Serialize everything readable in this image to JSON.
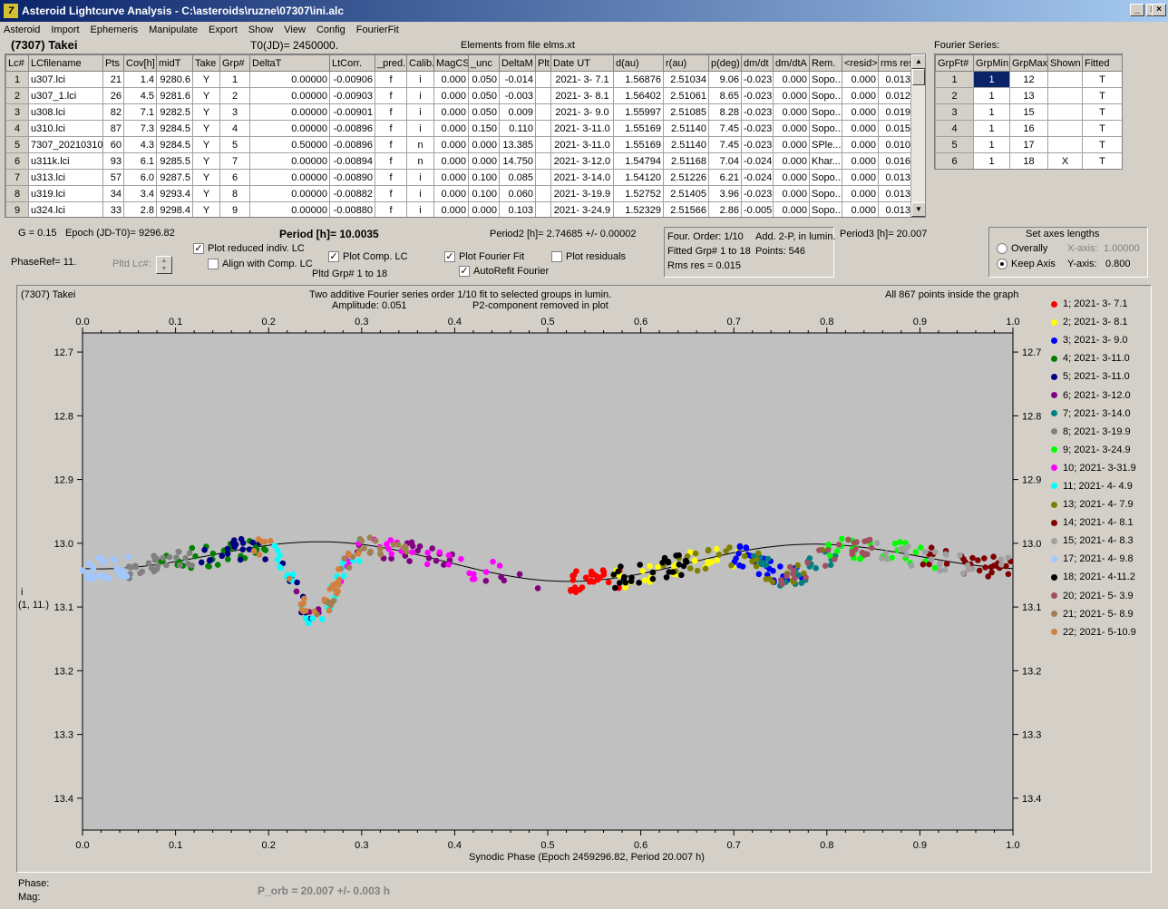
{
  "window": {
    "title": "Asteroid Lightcurve Analysis - C:\\asteroids\\ruzne\\07307\\ini.alc",
    "icon": "7",
    "min": "_",
    "max": "□",
    "close": "×"
  },
  "menu": [
    "Asteroid",
    "Import",
    "Ephemeris",
    "Manipulate",
    "Export",
    "Show",
    "View",
    "Config",
    "FourierFit"
  ],
  "asteroid_name": "(7307) Takei",
  "t0": "T0(JD)= 2450000.",
  "elements_note": "Elements from file elms.xt",
  "fourier_series_label": "Fourier Series:",
  "lc_table": {
    "headers": [
      "Lc#",
      "LCfilename",
      "Pts",
      "Cov[h]",
      "midT",
      "Take",
      "Grp#",
      "DeltaT",
      "LtCorr.",
      "_pred.",
      "Calib.",
      "MagCS",
      "_unc",
      "DeltaM",
      "Plt",
      "Date UT",
      "d(au)",
      "r(au)",
      "p(deg)",
      "dm/dt",
      "dm/dtA",
      "Rem.",
      "<resid>",
      "rms res"
    ],
    "rows": [
      [
        "1",
        "u307.lci",
        "21",
        "1.4",
        "9280.6",
        "Y",
        "1",
        "0.00000",
        "-0.00906",
        "f",
        "i",
        "0.000",
        "0.050",
        "-0.014",
        "",
        "2021- 3- 7.1",
        "1.56876",
        "2.51034",
        "9.06",
        "-0.023",
        "0.000",
        "Sopo...",
        "0.000",
        "0.013"
      ],
      [
        "2",
        "u307_1.lci",
        "26",
        "4.5",
        "9281.6",
        "Y",
        "2",
        "0.00000",
        "-0.00903",
        "f",
        "i",
        "0.000",
        "0.050",
        "-0.003",
        "",
        "2021- 3- 8.1",
        "1.56402",
        "2.51061",
        "8.65",
        "-0.023",
        "0.000",
        "Sopo...",
        "0.000",
        "0.012"
      ],
      [
        "3",
        "u308.lci",
        "82",
        "7.1",
        "9282.5",
        "Y",
        "3",
        "0.00000",
        "-0.00901",
        "f",
        "i",
        "0.000",
        "0.050",
        "0.009",
        "",
        "2021- 3- 9.0",
        "1.55997",
        "2.51085",
        "8.28",
        "-0.023",
        "0.000",
        "Sopo...",
        "0.000",
        "0.019"
      ],
      [
        "4",
        "u310.lci",
        "87",
        "7.3",
        "9284.5",
        "Y",
        "4",
        "0.00000",
        "-0.00896",
        "f",
        "i",
        "0.000",
        "0.150",
        "0.110",
        "",
        "2021- 3-11.0",
        "1.55169",
        "2.51140",
        "7.45",
        "-0.023",
        "0.000",
        "Sopo...",
        "0.000",
        "0.015"
      ],
      [
        "5",
        "7307_20210310",
        "60",
        "4.3",
        "9284.5",
        "Y",
        "5",
        "0.50000",
        "-0.00896",
        "f",
        "n",
        "0.000",
        "0.000",
        "13.385",
        "",
        "2021- 3-11.0",
        "1.55169",
        "2.51140",
        "7.45",
        "-0.023",
        "0.000",
        "SPle...",
        "0.000",
        "0.010"
      ],
      [
        "6",
        "u311k.lci",
        "93",
        "6.1",
        "9285.5",
        "Y",
        "7",
        "0.00000",
        "-0.00894",
        "f",
        "n",
        "0.000",
        "0.000",
        "14.750",
        "",
        "2021- 3-12.0",
        "1.54794",
        "2.51168",
        "7.04",
        "-0.024",
        "0.000",
        "Khar...",
        "0.000",
        "0.016"
      ],
      [
        "7",
        "u313.lci",
        "57",
        "6.0",
        "9287.5",
        "Y",
        "6",
        "0.00000",
        "-0.00890",
        "f",
        "i",
        "0.000",
        "0.100",
        "0.085",
        "",
        "2021- 3-14.0",
        "1.54120",
        "2.51226",
        "6.21",
        "-0.024",
        "0.000",
        "Sopo...",
        "0.000",
        "0.013"
      ],
      [
        "8",
        "u319.lci",
        "34",
        "3.4",
        "9293.4",
        "Y",
        "8",
        "0.00000",
        "-0.00882",
        "f",
        "i",
        "0.000",
        "0.100",
        "0.060",
        "",
        "2021- 3-19.9",
        "1.52752",
        "2.51405",
        "3.96",
        "-0.023",
        "0.000",
        "Sopo...",
        "0.000",
        "0.013"
      ],
      [
        "9",
        "u324.lci",
        "33",
        "2.8",
        "9298.4",
        "Y",
        "9",
        "0.00000",
        "-0.00880",
        "f",
        "i",
        "0.000",
        "0.000",
        "0.103",
        "",
        "2021- 3-24.9",
        "1.52329",
        "2.51566",
        "2.86",
        "-0.005",
        "0.000",
        "Sopo...",
        "0.000",
        "0.013"
      ]
    ]
  },
  "fourier_table": {
    "headers": [
      "GrpFt#",
      "GrpMin",
      "GrpMax",
      "Shown",
      "Fitted"
    ],
    "rows": [
      [
        "1",
        "1",
        "12",
        "",
        "T"
      ],
      [
        "2",
        "1",
        "13",
        "",
        "T"
      ],
      [
        "3",
        "1",
        "15",
        "",
        "T"
      ],
      [
        "4",
        "1",
        "16",
        "",
        "T"
      ],
      [
        "5",
        "1",
        "17",
        "",
        "T"
      ],
      [
        "6",
        "1",
        "18",
        "X",
        "T"
      ]
    ]
  },
  "params": {
    "g": "G = 0.15",
    "epoch": "Epoch (JD-T0)= 9296.82",
    "period": "Period [h]= 10.0035",
    "period2": "Period2 [h]= 2.74685 +/- 0.00002",
    "period3": "Period3 [h]= 20.007",
    "phase_ref": "PhaseRef= 11.",
    "pltd_lc": "Pltd Lc#:",
    "pltd_grp": "Pltd Grp#  1   to   18"
  },
  "checks": {
    "plot_reduced": "Plot reduced indiv. LC",
    "align": "Align with Comp. LC",
    "plot_comp": "Plot Comp. LC",
    "plot_fourier": "Plot Fourier Fit",
    "autorefit": "AutoRefit Fourier",
    "plot_residuals": "Plot residuals"
  },
  "fit_info": {
    "order": "Four. Order:  1/10",
    "add": "Add. 2-P, in lumin.",
    "fitted": "Fitted Grp# 1 to 18",
    "points": "Points: 546",
    "rms": "Rms res      = 0.015"
  },
  "axes": {
    "title": "Set axes lengths",
    "overall": "Overally",
    "keep": "Keep Axis",
    "xaxis": "X-axis:",
    "xval": "1.00000",
    "yaxis": "Y-axis:",
    "yval": "0.800"
  },
  "plot_header": {
    "name": "(7307) Takei",
    "line1": "Two additive Fourier series order 1/10 fit to selected groups in lumin.",
    "amp": "Amplitude: 0.051",
    "p2": "P2-component removed in plot",
    "inside": "All 867 points inside the graph",
    "ylabel1": "i",
    "ylabel2": "(1, 11.)"
  },
  "chart_data": {
    "type": "scatter",
    "xlabel": "Synodic Phase (Epoch 2459296.82, Period 20.007 h)",
    "xlim": [
      0.0,
      1.0
    ],
    "ylim": [
      13.45,
      12.67
    ],
    "xticks": [
      "0.0",
      "0.1",
      "0.2",
      "0.3",
      "0.4",
      "0.5",
      "0.6",
      "0.7",
      "0.8",
      "0.9",
      "1.0"
    ],
    "yticks": [
      "12.7",
      "12.8",
      "12.9",
      "13.0",
      "13.1",
      "13.2",
      "13.3",
      "13.4"
    ],
    "series": [
      {
        "name": "1; 2021- 3- 7.1",
        "color": "#ff0000",
        "range": [
          0.52,
          0.58
        ]
      },
      {
        "name": "2; 2021- 3- 8.1",
        "color": "#ffff00",
        "range": [
          0.57,
          0.72
        ]
      },
      {
        "name": "3; 2021- 3- 9.0",
        "color": "#0000ff",
        "range": [
          0.7,
          0.78
        ]
      },
      {
        "name": "4; 2021- 3-11.0",
        "color": "#008000",
        "range": [
          0.08,
          0.2
        ]
      },
      {
        "name": "5; 2021- 3-11.0",
        "color": "#000080",
        "range": [
          0.12,
          0.25
        ]
      },
      {
        "name": "6; 2021- 3-12.0",
        "color": "#800080",
        "range": [
          0.23,
          0.5
        ]
      },
      {
        "name": "7; 2021- 3-14.0",
        "color": "#008080",
        "range": [
          0.72,
          0.82
        ]
      },
      {
        "name": "8; 2021- 3-19.9",
        "color": "#808080",
        "range": [
          0.05,
          0.12
        ]
      },
      {
        "name": "9; 2021- 3-24.9",
        "color": "#00ff00",
        "range": [
          0.8,
          0.92
        ]
      },
      {
        "name": "10; 2021- 3-31.9",
        "color": "#ff00ff",
        "range": [
          0.27,
          0.45
        ]
      },
      {
        "name": "11; 2021- 4- 4.9",
        "color": "#00ffff",
        "range": [
          0.2,
          0.3
        ]
      },
      {
        "name": "13; 2021- 4- 7.9",
        "color": "#808000",
        "range": [
          0.62,
          0.8
        ]
      },
      {
        "name": "14; 2021- 4- 8.1",
        "color": "#800000",
        "range": [
          0.9,
          1.0
        ]
      },
      {
        "name": "15; 2021- 4- 8.3",
        "color": "#a0a0a0",
        "range": [
          0.85,
          1.0
        ]
      },
      {
        "name": "17; 2021- 4- 9.8",
        "color": "#a0c8ff",
        "range": [
          0.0,
          0.05
        ]
      },
      {
        "name": "18; 2021- 4-11.2",
        "color": "#000000",
        "range": [
          0.57,
          0.65
        ]
      },
      {
        "name": "20; 2021- 5- 3.9",
        "color": "#a05060",
        "range": [
          0.75,
          0.85
        ]
      },
      {
        "name": "21; 2021- 5- 8.9",
        "color": "#a08050",
        "range": [
          0.25,
          0.35
        ]
      },
      {
        "name": "22; 2021- 5-10.9",
        "color": "#d08040",
        "range": [
          0.18,
          0.3
        ]
      }
    ]
  },
  "status": {
    "phase": "Phase:",
    "mag": "Mag:",
    "porb": "P_orb = 20.007 +/- 0.003 h"
  }
}
